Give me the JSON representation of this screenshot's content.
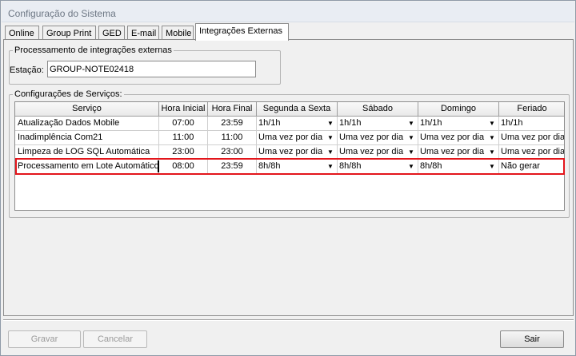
{
  "window": {
    "title": "Configuração do Sistema"
  },
  "tabs": [
    {
      "label": "Online"
    },
    {
      "label": "Group Print"
    },
    {
      "label": "GED"
    },
    {
      "label": "E-mail"
    },
    {
      "label": "Mobile"
    },
    {
      "label": "Integrações Externas",
      "active": true
    }
  ],
  "integracoes": {
    "legend": "Processamento de integrações externas",
    "estacao_label": "Estação:",
    "estacao_value": "GROUP-NOTE02418"
  },
  "servicos": {
    "legend": "Configurações de Serviços:",
    "columns": [
      "Serviço",
      "Hora Inicial",
      "Hora Final",
      "Segunda a Sexta",
      "Sábado",
      "Domingo",
      "Feriado"
    ],
    "rows": [
      {
        "servico": "Atualização Dados Mobile",
        "hora_inicial": "07:00",
        "hora_final": "23:59",
        "segunda_sexta": "1h/1h",
        "sabado": "1h/1h",
        "domingo": "1h/1h",
        "feriado": "1h/1h"
      },
      {
        "servico": "Inadimplência Com21",
        "hora_inicial": "11:00",
        "hora_final": "11:00",
        "segunda_sexta": "Uma vez por dia",
        "sabado": "Uma vez por dia",
        "domingo": "Uma vez por dia",
        "feriado": "Uma vez por dia"
      },
      {
        "servico": "Limpeza de LOG SQL Automática",
        "hora_inicial": "23:00",
        "hora_final": "23:00",
        "segunda_sexta": "Uma vez por dia",
        "sabado": "Uma vez por dia",
        "domingo": "Uma vez por dia",
        "feriado": "Uma vez por dia"
      },
      {
        "servico": "Processamento em Lote Automático",
        "hora_inicial": "08:00",
        "hora_final": "23:59",
        "segunda_sexta": "8h/8h",
        "sabado": "8h/8h",
        "domingo": "8h/8h",
        "feriado": "Não gerar",
        "highlighted": true
      }
    ]
  },
  "buttons": {
    "gravar": "Gravar",
    "cancelar": "Cancelar",
    "sair": "Sair"
  },
  "colors": {
    "highlight_border": "#e3151b",
    "title_text": "#6d7784"
  }
}
